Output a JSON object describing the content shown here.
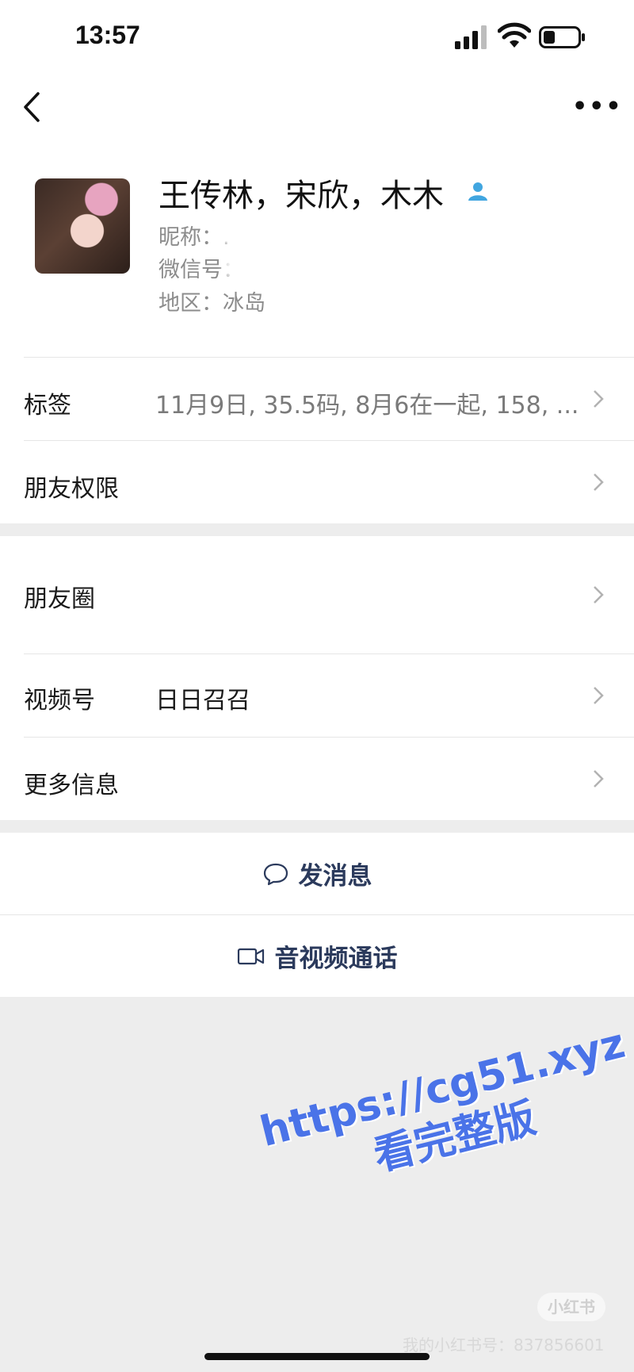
{
  "status_bar": {
    "time": "13:57"
  },
  "profile": {
    "name": "王传林，宋欣，木木",
    "nickname": "昵称：.",
    "wechat_id": "微信号：",
    "region": "地区：冰岛"
  },
  "rows": {
    "tags": {
      "label": "标签",
      "value": "11月9日, 35.5码, 8月6在一起, 158, ..."
    },
    "permissions": {
      "label": "朋友权限"
    },
    "moments": {
      "label": "朋友圈"
    },
    "channels": {
      "label": "视频号",
      "value": "日日召召"
    },
    "more_info": {
      "label": "更多信息"
    }
  },
  "actions": {
    "message": "发消息",
    "av_call": "音视频通话"
  },
  "overlay": {
    "watermark_url": "https://cg51.xyz",
    "watermark_text": "看完整版",
    "source_logo": "小红书",
    "source_id": "我的小红书号：837856601"
  },
  "colors": {
    "background": "#ededed",
    "action_text": "#2b3a5c",
    "contact_icon": "#41a6e0",
    "watermark": "#4a73e8"
  },
  "icons": [
    "back-chevron-icon",
    "more-dots-icon",
    "contact-icon",
    "chevron-right-icon",
    "chat-bubble-icon",
    "video-camera-icon",
    "signal-icon",
    "wifi-icon",
    "battery-icon"
  ]
}
